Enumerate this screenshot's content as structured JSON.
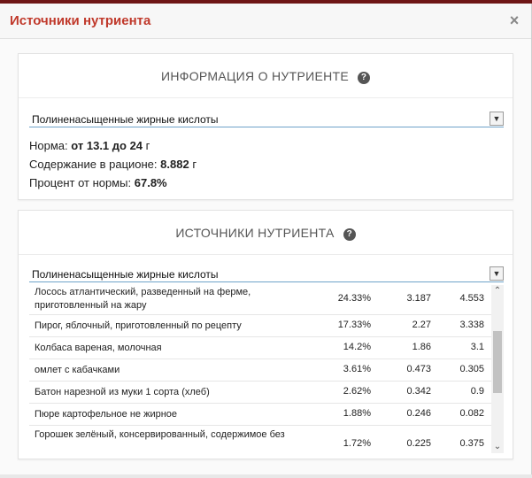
{
  "modal": {
    "title": "Источники нутриента",
    "close_label": "×"
  },
  "info_panel": {
    "heading": "ИНФОРМАЦИЯ О НУТРИЕНТЕ",
    "selected_nutrient": "Полиненасыщенные жирные кислоты",
    "norm_label": "Норма:",
    "norm_value": "от 13.1 до 24",
    "norm_unit": "г",
    "content_label": "Содержание в рационе:",
    "content_value": "8.882",
    "content_unit": "г",
    "percent_label": "Процент от нормы:",
    "percent_value": "67.8%"
  },
  "sources_panel": {
    "heading": "ИСТОЧНИКИ НУТРИЕНТА",
    "selected_nutrient": "Полиненасыщенные жирные кислоты",
    "rows": [
      {
        "name": "Лосось атлантический, разведенный на ферме, приготовленный на жару",
        "percent": "24.33%",
        "amount": "3.187",
        "total": "4.553"
      },
      {
        "name": "Пирог, яблочный, приготовленный по рецепту",
        "percent": "17.33%",
        "amount": "2.27",
        "total": "3.338"
      },
      {
        "name": "Колбаса вареная, молочная",
        "percent": "14.2%",
        "amount": "1.86",
        "total": "3.1"
      },
      {
        "name": "омлет с кабачками",
        "percent": "3.61%",
        "amount": "0.473",
        "total": "0.305"
      },
      {
        "name": "Батон нарезной из муки 1 сорта (хлеб)",
        "percent": "2.62%",
        "amount": "0.342",
        "total": "0.9"
      },
      {
        "name": "Пюре картофельное не жирное",
        "percent": "1.88%",
        "amount": "0.246",
        "total": "0.082"
      },
      {
        "name": "Горошек зелёный, консервированный, содержимое без",
        "percent": "1.72%",
        "amount": "0.225",
        "total": "0.375"
      }
    ]
  },
  "icons": {
    "help": "question-circle-icon",
    "close": "close-icon",
    "dropdown": "chevron-down-icon"
  },
  "colors": {
    "title": "#c0392b",
    "topbar": "#6e1616",
    "select_underline": "#6fa3c9"
  }
}
